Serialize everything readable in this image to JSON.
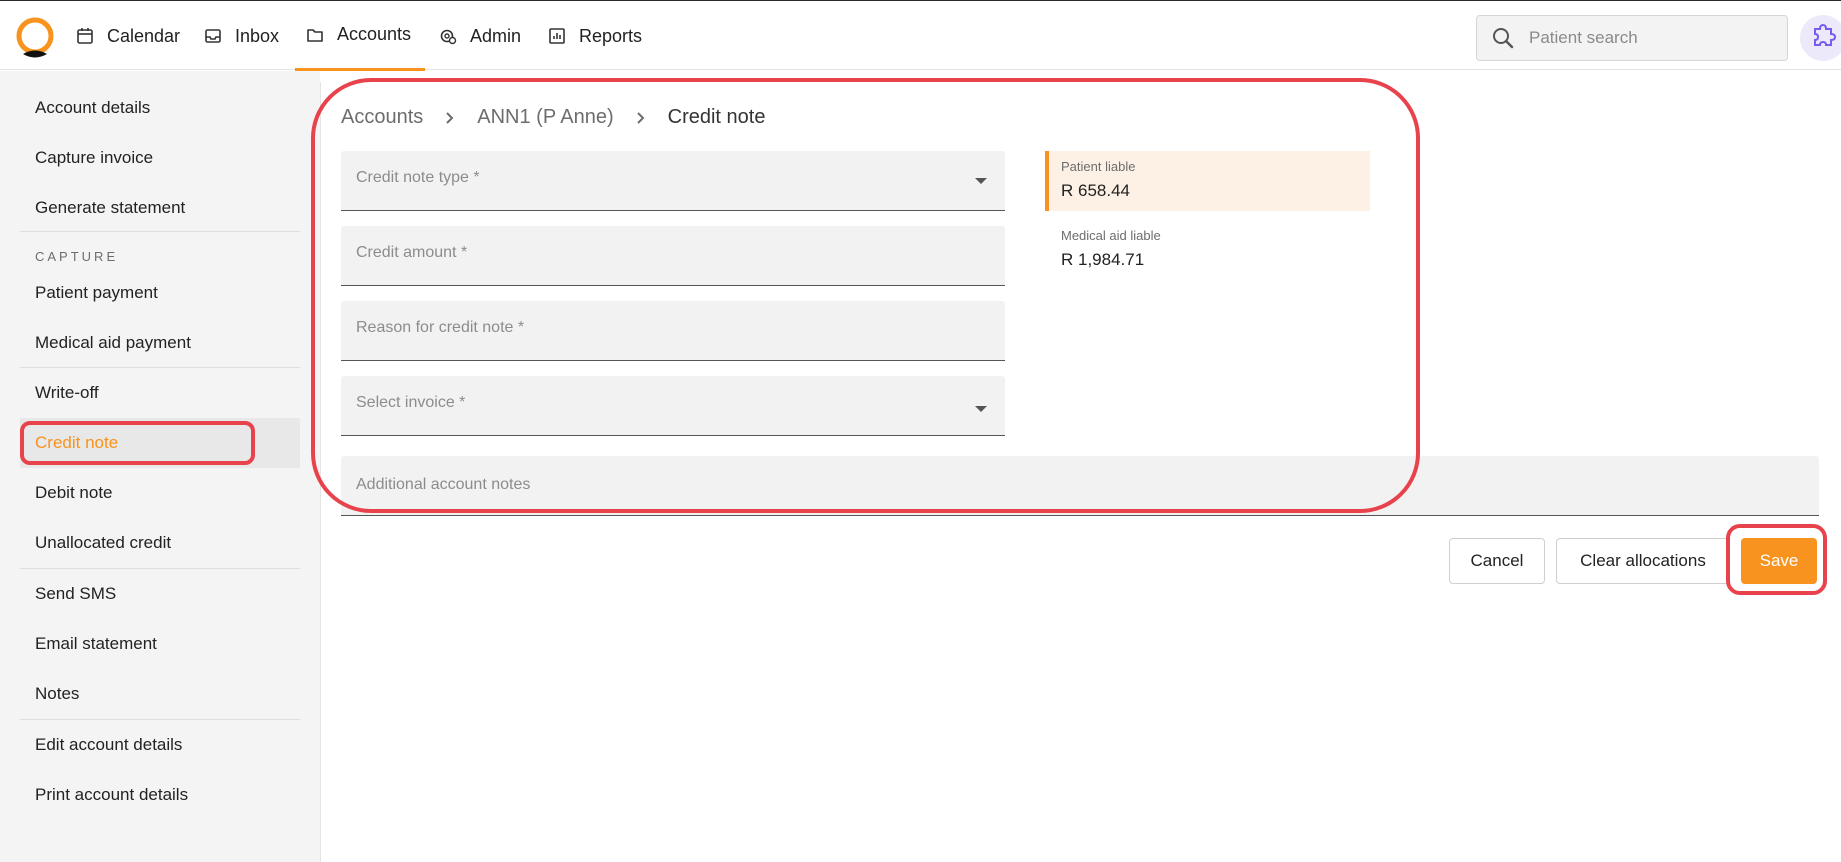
{
  "nav": {
    "items": [
      {
        "label": "Calendar",
        "icon": "calendar-icon"
      },
      {
        "label": "Inbox",
        "icon": "inbox-icon"
      },
      {
        "label": "Accounts",
        "icon": "folder-icon",
        "active": true
      },
      {
        "label": "Admin",
        "icon": "admin-gear-icon"
      },
      {
        "label": "Reports",
        "icon": "bar-chart-icon"
      }
    ],
    "search_placeholder": "Patient search"
  },
  "sidebar": {
    "items": [
      {
        "label": "Account details"
      },
      {
        "label": "Capture invoice"
      },
      {
        "label": "Generate statement"
      },
      {
        "label": "Patient payment"
      },
      {
        "label": "Medical aid payment"
      },
      {
        "label": "Write-off"
      },
      {
        "label": "Credit note",
        "active": true
      },
      {
        "label": "Debit note"
      },
      {
        "label": "Unallocated credit"
      },
      {
        "label": "Send SMS"
      },
      {
        "label": "Email statement"
      },
      {
        "label": "Notes"
      },
      {
        "label": "Edit account details"
      },
      {
        "label": "Print account details"
      }
    ],
    "section_capture": "CAPTURE"
  },
  "breadcrumb": {
    "items": [
      "Accounts",
      "ANN1 (P Anne)",
      "Credit note"
    ]
  },
  "form": {
    "credit_note_type": "Credit note type *",
    "credit_amount": "Credit amount *",
    "reason": "Reason for credit note *",
    "select_invoice": "Select invoice *",
    "additional_notes": "Additional account notes"
  },
  "liability": {
    "patient_label": "Patient liable",
    "patient_value": "R 658.44",
    "medaid_label": "Medical aid liable",
    "medaid_value": "R 1,984.71"
  },
  "actions": {
    "cancel": "Cancel",
    "clear": "Clear allocations",
    "save": "Save"
  },
  "colors": {
    "accent": "#f7931e",
    "highlight": "#e8434c"
  }
}
